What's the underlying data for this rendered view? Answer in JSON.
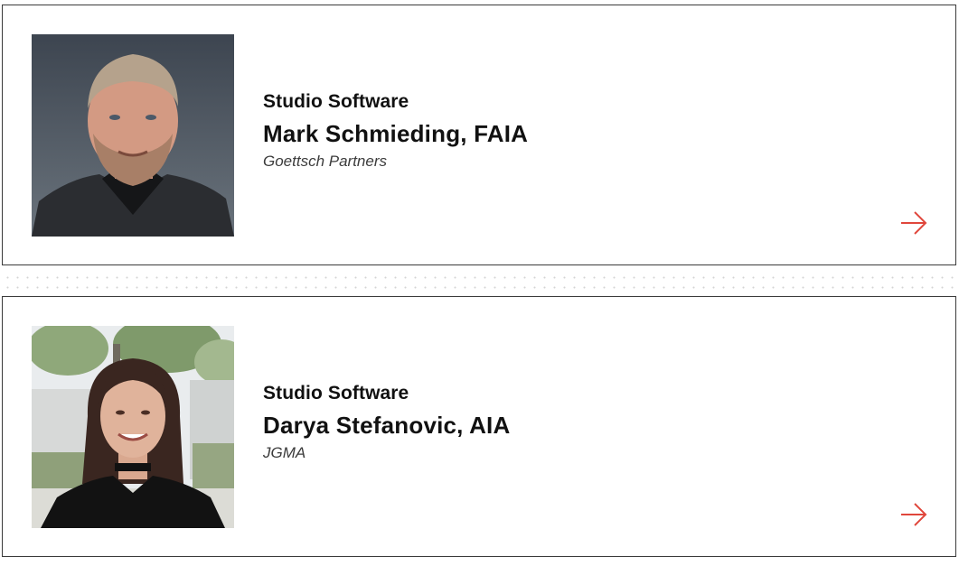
{
  "speakers": [
    {
      "category": "Studio Software",
      "name": "Mark Schmieding, FAIA",
      "company": "Goettsch Partners",
      "photo_icon": "person-photo"
    },
    {
      "category": "Studio Software",
      "name": "Darya Stefanovic, AIA",
      "company": "JGMA",
      "photo_icon": "person-photo"
    }
  ],
  "colors": {
    "accent": "#e0463b",
    "text": "#111111",
    "border": "#3a3a3a"
  },
  "icons": {
    "link": "arrow-right-icon"
  }
}
